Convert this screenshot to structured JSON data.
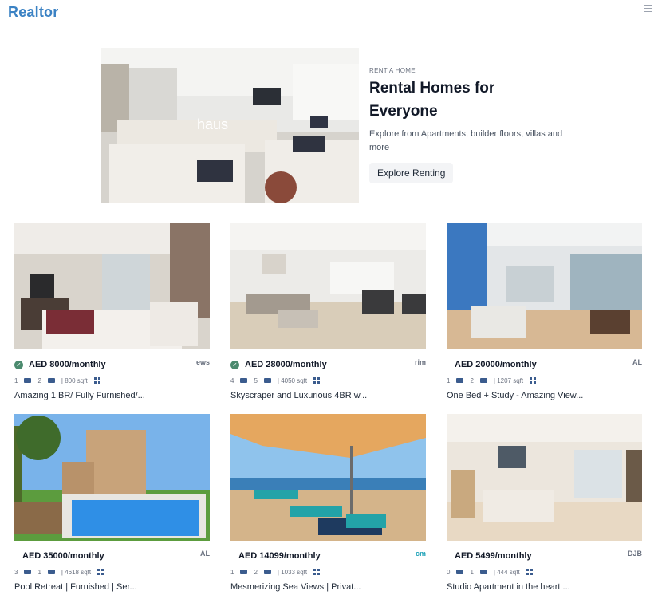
{
  "header": {
    "brand": "Realtor"
  },
  "hero": {
    "eyebrow": "RENT A HOME",
    "title": "Rental Homes for Everyone",
    "description": "Explore from Apartments, builder floors, villas and more",
    "button_label": "Explore Renting",
    "image_watermark": "haus"
  },
  "listings": [
    {
      "price": "AED 8000/monthly",
      "verified": true,
      "agency": "ews",
      "beds": "1",
      "baths": "2",
      "area": "| 800 sqft",
      "title": "Amazing 1 BR/ Fully Furnished/..."
    },
    {
      "price": "AED 28000/monthly",
      "verified": true,
      "agency": "rim",
      "beds": "4",
      "baths": "5",
      "area": "| 4050 sqft",
      "title": "Skyscraper and Luxurious 4BR w..."
    },
    {
      "price": "AED 20000/monthly",
      "verified": false,
      "agency": "AL",
      "beds": "1",
      "baths": "2",
      "area": "| 1207 sqft",
      "title": "One Bed + Study - Amazing View..."
    },
    {
      "price": "AED 35000/monthly",
      "verified": false,
      "agency": "AL",
      "beds": "3",
      "baths": "1",
      "area": "| 4618 sqft",
      "title": "Pool Retreat | Furnished | Ser..."
    },
    {
      "price": "AED 14099/monthly",
      "verified": false,
      "agency": "cm",
      "beds": "1",
      "baths": "2",
      "area": "| 1033 sqft",
      "title": "Mesmerizing Sea Views | Privat..."
    },
    {
      "price": "AED 5499/monthly",
      "verified": false,
      "agency": "DJB",
      "beds": "0",
      "baths": "1",
      "area": "| 444 sqft",
      "title": "Studio Apartment in the heart ..."
    }
  ]
}
